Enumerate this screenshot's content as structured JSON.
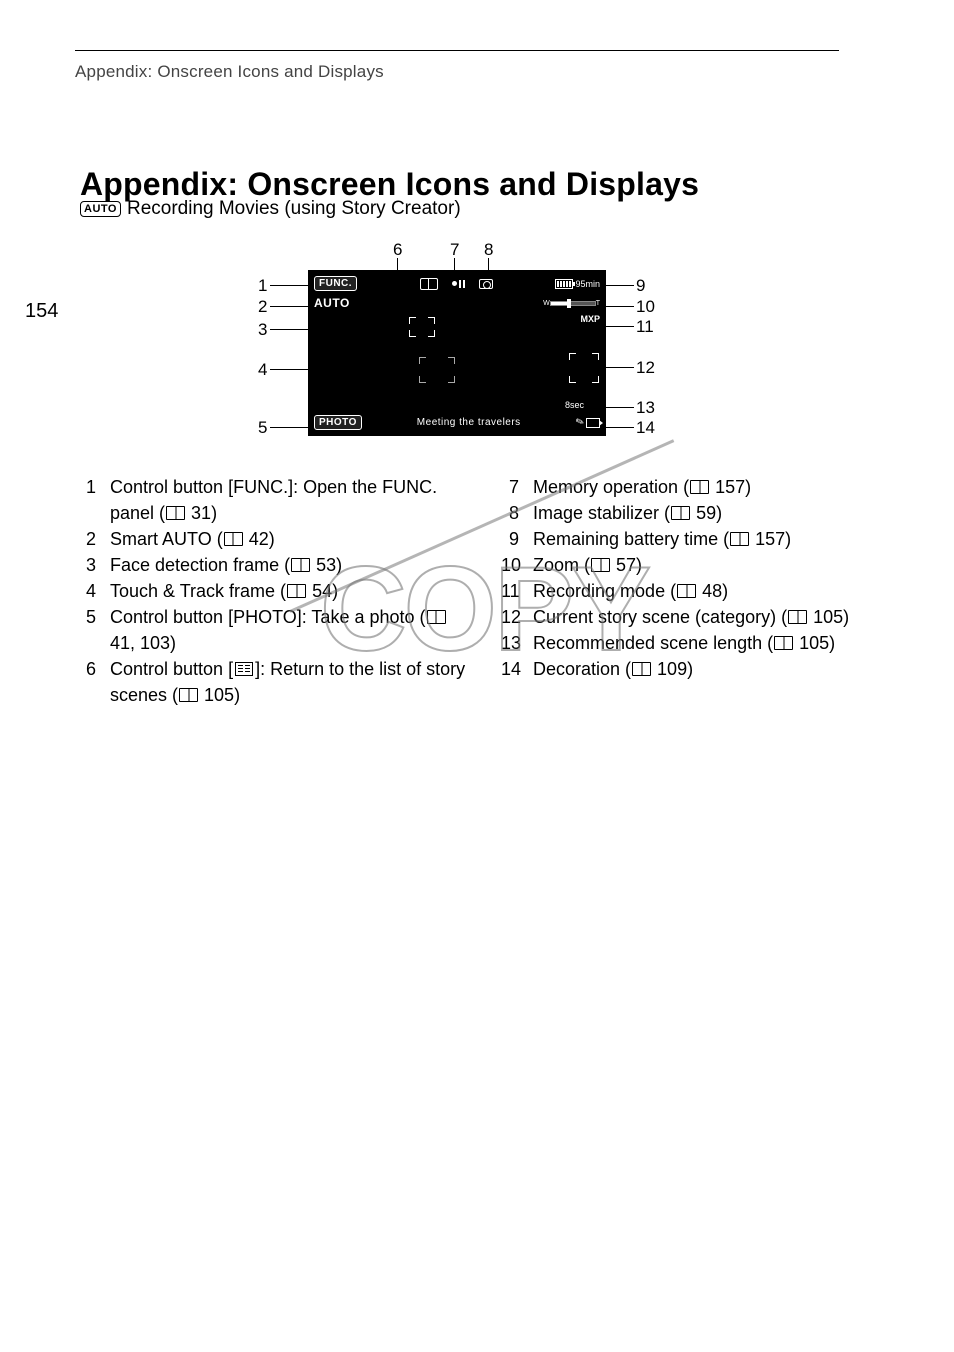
{
  "breadcrumb": "Appendix: Onscreen Icons and Displays",
  "page_number": "154",
  "title": "Appendix: Onscreen Icons and Displays",
  "subtitle_badge": "AUTO",
  "subtitle_text": "Recording Movies (using Story Creator)",
  "watermark": "COPY",
  "diagram": {
    "callouts_top": {
      "c6": "6",
      "c7": "7",
      "c8": "8"
    },
    "callouts_left": {
      "c1": "1",
      "c2": "2",
      "c3": "3",
      "c4": "4",
      "c5": "5"
    },
    "callouts_right": {
      "c9": "9",
      "c10": "10",
      "c11": "11",
      "c12": "12",
      "c13": "13",
      "c14": "14"
    },
    "screen": {
      "func_label": "FUNC.",
      "auto_label": "AUTO",
      "photo_label": "PHOTO",
      "batt_text": "95min",
      "mxp": "MXP",
      "sec": "8sec",
      "scene": "Meeting the travelers",
      "zoom_w": "W",
      "zoom_t": "T"
    }
  },
  "legend_left": [
    {
      "n": "1",
      "text": "Control button [FUNC.]: Open the FUNC. panel (",
      "ref": " 31)"
    },
    {
      "n": "2",
      "text": "Smart AUTO (",
      "ref": " 42)"
    },
    {
      "n": "3",
      "text": "Face detection frame (",
      "ref": " 53)"
    },
    {
      "n": "4",
      "text": "Touch & Track frame (",
      "ref": " 54)"
    },
    {
      "n": "5",
      "text": "Control button [PHOTO]: Take a photo (",
      "ref": " 41, 103)"
    },
    {
      "n": "6",
      "text_pre": "Control button [",
      "text_mid": "]: Return to the list of story scenes (",
      "ref": " 105)"
    }
  ],
  "legend_right": [
    {
      "n": "7",
      "text": "Memory operation (",
      "ref": " 157)"
    },
    {
      "n": "8",
      "text": "Image stabilizer (",
      "ref": " 59)"
    },
    {
      "n": "9",
      "text": "Remaining battery time (",
      "ref": " 157)"
    },
    {
      "n": "10",
      "text": "Zoom (",
      "ref": " 57)"
    },
    {
      "n": "11",
      "text": "Recording mode (",
      "ref": " 48)"
    },
    {
      "n": "12",
      "text": "Current story scene (category) (",
      "ref": " 105)"
    },
    {
      "n": "13",
      "text": "Recommended scene length (",
      "ref": " 105)"
    },
    {
      "n": "14",
      "text": "Decoration (",
      "ref": " 109)"
    }
  ]
}
